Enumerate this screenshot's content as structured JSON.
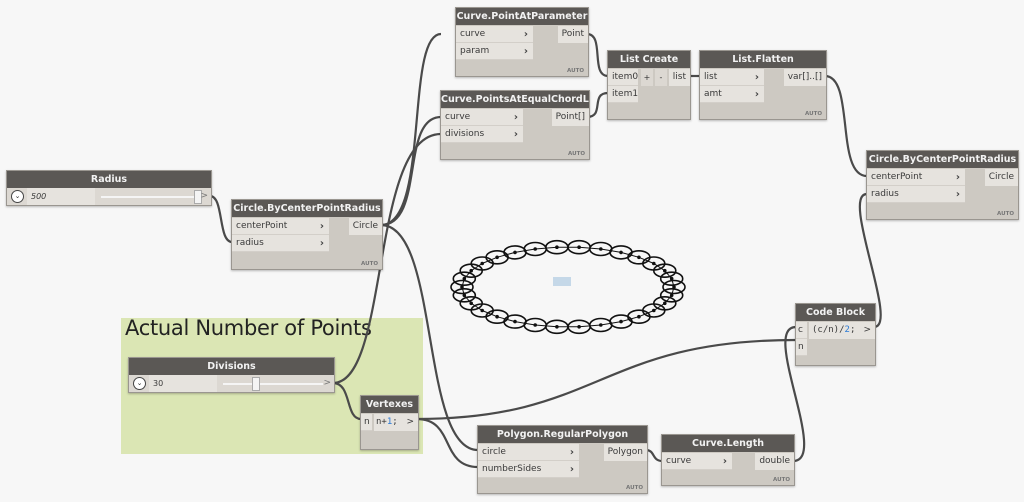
{
  "canvas": {
    "background": "#f7f7f7",
    "node_header_color": "#5b5855",
    "node_body_color": "#cdc9c2",
    "group_color": "#dbe6b4"
  },
  "group": {
    "title": "Actual Number of Points"
  },
  "nodes": {
    "radius_slider": {
      "title": "Radius",
      "value": "500",
      "value_fraction": 0.97,
      "output": ">"
    },
    "divisions_slider": {
      "title": "Divisions",
      "value": "30",
      "value_fraction": 0.3,
      "output": ">"
    },
    "circle1": {
      "title": "Circle.ByCenterPointRadius",
      "inputs": [
        "centerPoint",
        "radius"
      ],
      "output": "Circle",
      "lacing": "AUTO"
    },
    "point_at_param": {
      "title": "Curve.PointAtParameter",
      "inputs": [
        "curve",
        "param"
      ],
      "output": "Point",
      "lacing": "AUTO"
    },
    "points_equal_chord": {
      "title": "Curve.PointsAtEqualChordLength",
      "inputs": [
        "curve",
        "divisions"
      ],
      "output": "Point[]",
      "lacing": "AUTO"
    },
    "list_create": {
      "title": "List Create",
      "inputs": [
        "item0",
        "item1"
      ],
      "add_label": "+",
      "remove_label": "-",
      "output": "list"
    },
    "list_flatten": {
      "title": "List.Flatten",
      "inputs": [
        "list",
        "amt"
      ],
      "output": "var[]..[]",
      "lacing": "AUTO"
    },
    "circle2": {
      "title": "Circle.ByCenterPointRadius",
      "inputs": [
        "centerPoint",
        "radius"
      ],
      "output": "Circle",
      "lacing": "AUTO"
    },
    "code_block": {
      "title": "Code Block",
      "inputs": [
        "c",
        "n"
      ],
      "code_pre": "(c/n)/",
      "code_num": "2",
      "code_post": ";",
      "output": ">"
    },
    "vertexes": {
      "title": "Vertexes",
      "inputs": [
        "n"
      ],
      "code_pre": "n+",
      "code_num": "1",
      "code_post": ";",
      "output": ">"
    },
    "regular_polygon": {
      "title": "Polygon.RegularPolygon",
      "inputs": [
        "circle",
        "numberSides"
      ],
      "output": "Polygon",
      "lacing": "AUTO"
    },
    "curve_length": {
      "title": "Curve.Length",
      "inputs": [
        "curve"
      ],
      "output": "double",
      "lacing": "AUTO"
    }
  },
  "geometry_preview": {
    "ring_circle_count": 30
  }
}
